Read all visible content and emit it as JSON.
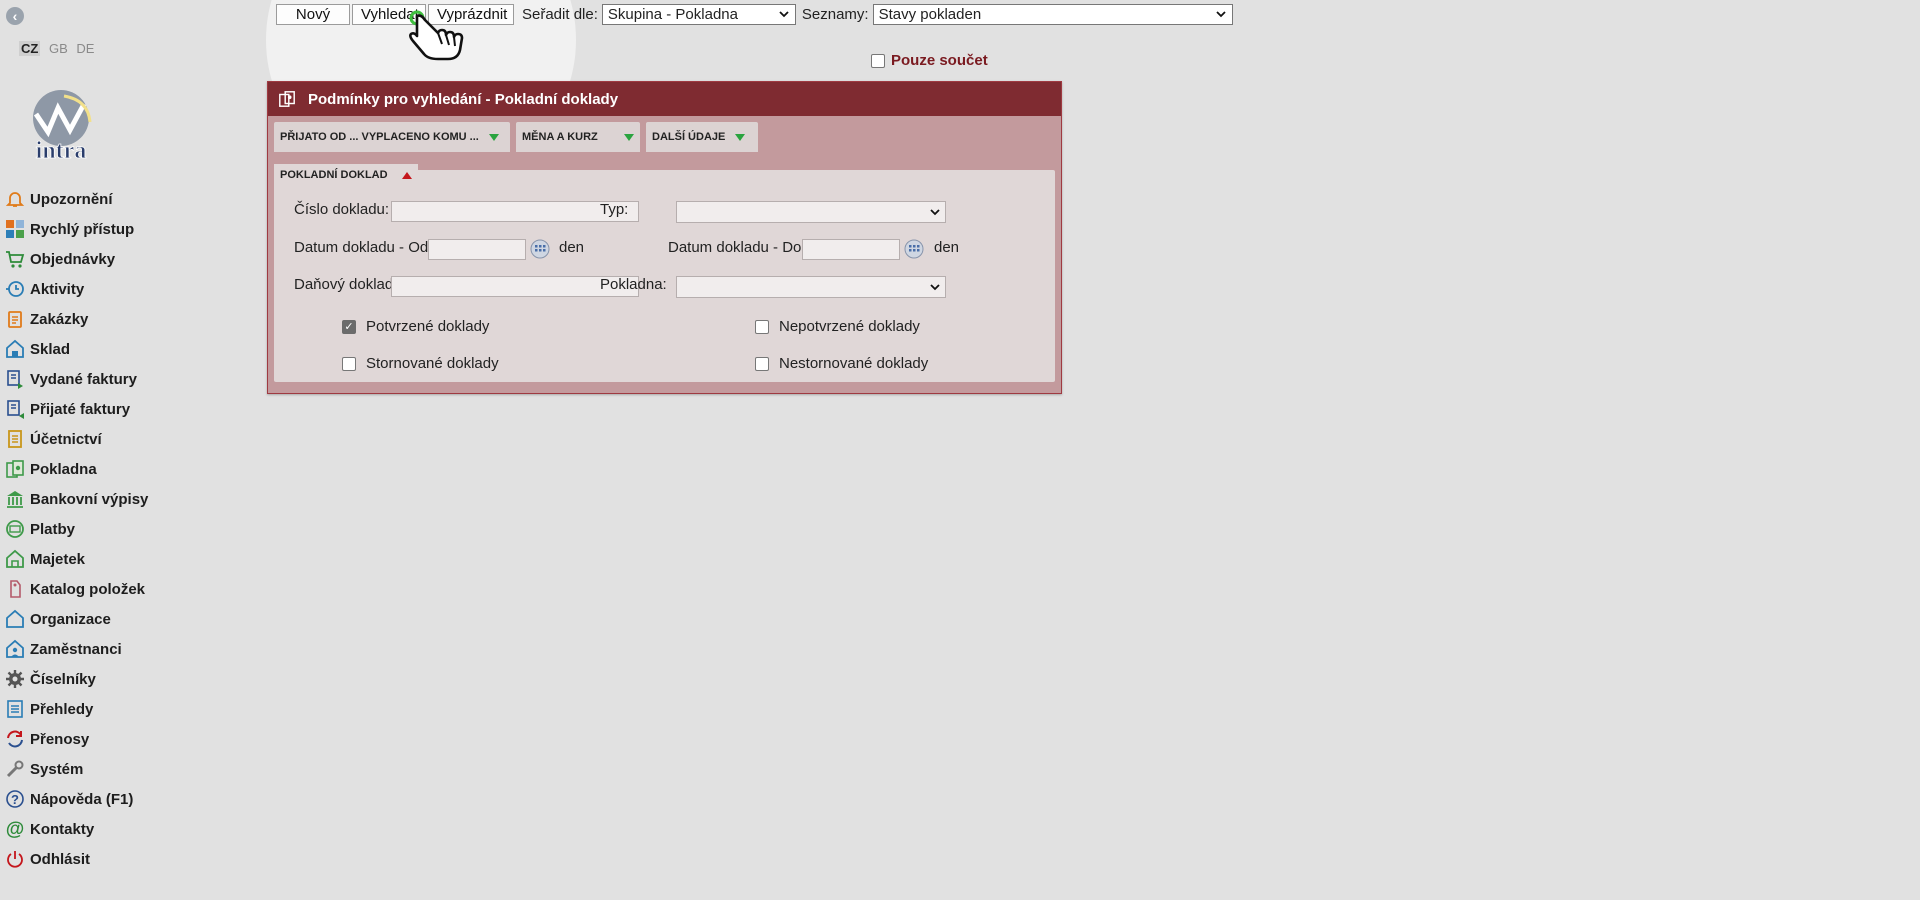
{
  "sidebar": {
    "languages": [
      "CZ",
      "GB",
      "DE"
    ],
    "logo_text": "intra",
    "items": [
      {
        "label": "Upozornění",
        "icon": "bell-icon"
      },
      {
        "label": "Rychlý přístup",
        "icon": "tiles-icon"
      },
      {
        "label": "Objednávky",
        "icon": "cart-icon"
      },
      {
        "label": "Aktivity",
        "icon": "clock-icon"
      },
      {
        "label": "Zakázky",
        "icon": "clipboard-icon"
      },
      {
        "label": "Sklad",
        "icon": "warehouse-icon"
      },
      {
        "label": "Vydané faktury",
        "icon": "invoice-out-icon"
      },
      {
        "label": "Přijaté faktury",
        "icon": "invoice-in-icon"
      },
      {
        "label": "Účetnictví",
        "icon": "ledger-icon"
      },
      {
        "label": "Pokladna",
        "icon": "cashbox-icon"
      },
      {
        "label": "Bankovní výpisy",
        "icon": "bank-icon"
      },
      {
        "label": "Platby",
        "icon": "payment-icon"
      },
      {
        "label": "Majetek",
        "icon": "property-icon"
      },
      {
        "label": "Katalog položek",
        "icon": "tag-icon"
      },
      {
        "label": "Organizace",
        "icon": "organization-icon"
      },
      {
        "label": "Zaměstnanci",
        "icon": "employees-icon"
      },
      {
        "label": "Číselníky",
        "icon": "gear-icon"
      },
      {
        "label": "Přehledy",
        "icon": "report-icon"
      },
      {
        "label": "Přenosy",
        "icon": "sync-icon"
      },
      {
        "label": "Systém",
        "icon": "wrench-icon"
      },
      {
        "label": "Nápověda (F1)",
        "icon": "help-icon"
      },
      {
        "label": "Kontakty",
        "icon": "at-icon"
      },
      {
        "label": "Odhlásit",
        "icon": "power-icon"
      }
    ]
  },
  "toolbar": {
    "new_label": "Nový",
    "search_label": "Vyhledat",
    "clear_label": "Vyprázdnit",
    "sort_label": "Seřadit dle:",
    "sort_value": "Skupina - Pokladna",
    "lists_label": "Seznamy:",
    "lists_value": "Stavy pokladen",
    "sum_only_label": "Pouze součet",
    "sum_only_checked": false
  },
  "panel": {
    "title": "Podmínky pro vyhledání - Pokladní doklady",
    "tabs": [
      "PŘIJATO OD ... VYPLACENO KOMU ...",
      "MĚNA A KURZ",
      "DALŠÍ ÚDAJE"
    ],
    "section_title": "POKLADNÍ DOKLAD",
    "fields": {
      "doc_number_label": "Číslo dokladu:",
      "type_label": "Typ:",
      "date_from_label": "Datum dokladu - Od:",
      "date_to_label": "Datum dokladu - Do:",
      "day_unit": "den",
      "tax_doc_label": "Daňový doklad:",
      "cashbox_label": "Pokladna:"
    },
    "checkboxes": {
      "confirmed": {
        "label": "Potvrzené doklady",
        "checked": true
      },
      "unconfirmed": {
        "label": "Nepotvrzené doklady",
        "checked": false
      },
      "cancelled": {
        "label": "Stornované doklady",
        "checked": false
      },
      "not_cancelled": {
        "label": "Nestornované doklady",
        "checked": false
      }
    }
  },
  "colors": {
    "panel_header": "#7f2b31",
    "panel_body": "#c39a9d",
    "sum_label": "#7a1a20"
  }
}
